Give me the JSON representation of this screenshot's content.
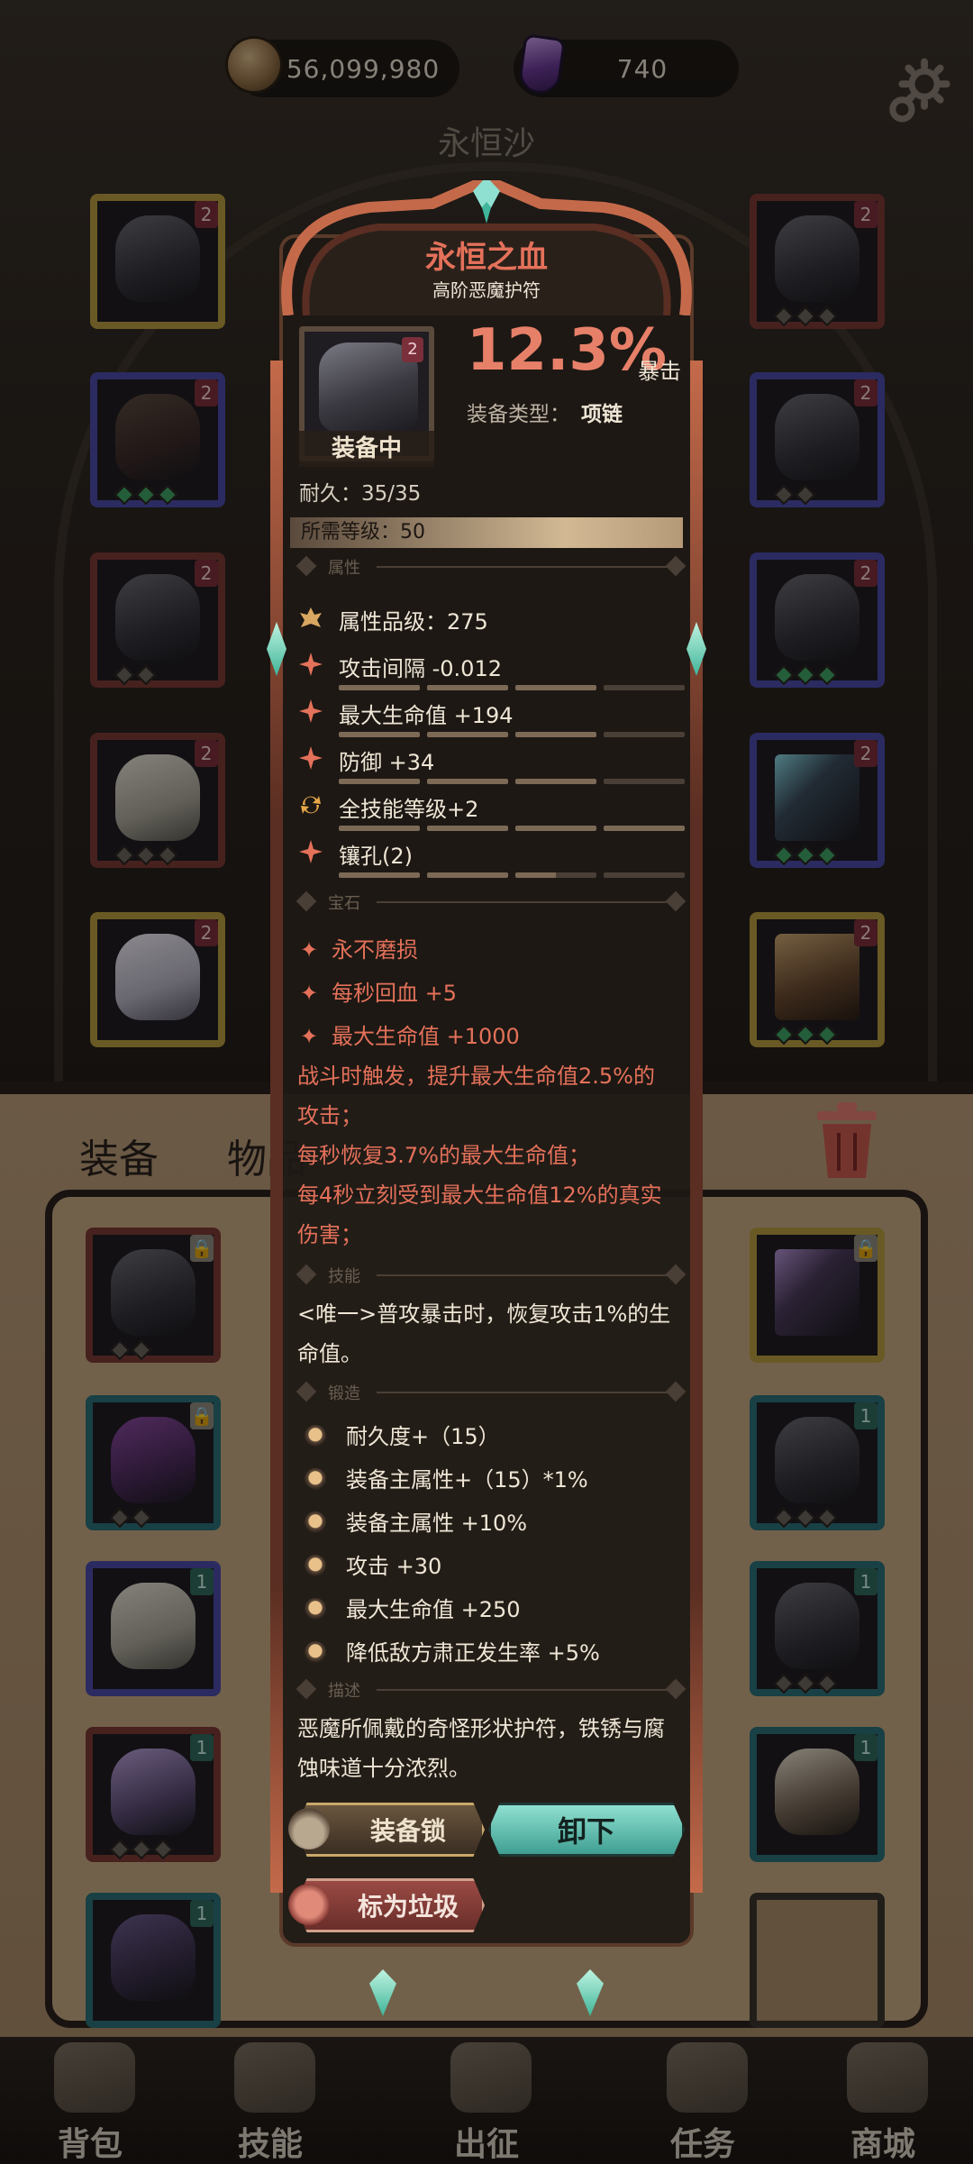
{
  "resources": {
    "gold": "56,099,980",
    "gems": "740"
  },
  "stage_title": "永恒沙",
  "category_tabs": {
    "equip": "装备",
    "items": "物品"
  },
  "bottom_nav": [
    {
      "label": "背包",
      "icon": "backpack-icon"
    },
    {
      "label": "技能",
      "icon": "skill-book-icon"
    },
    {
      "label": "出征",
      "icon": "battle-banner-icon"
    },
    {
      "label": "任务",
      "icon": "quest-scroll-icon"
    },
    {
      "label": "商城",
      "icon": "shop-crown-icon"
    }
  ],
  "slot_badges": {
    "tier": "2",
    "upgrade": "1"
  },
  "tooltip": {
    "name": "永恒之血",
    "subtitle": "高阶恶魔护符",
    "icon_badge": "2",
    "equipped": "装备中",
    "main_value": "12.3%",
    "main_stat": "暴击",
    "type_label": "装备类型：",
    "type_value": "项链",
    "durability": "耐久：35/35",
    "required_level": "所需等级：50",
    "sections": {
      "attributes": "属性",
      "gems": "宝石",
      "skill": "技能",
      "forge": "锻造",
      "description": "描述"
    },
    "attributes": [
      {
        "text": "属性品级：275",
        "icon": "quality-crest-icon"
      },
      {
        "text": "攻击间隔 -0.012",
        "icon": "attribute-sparkle-icon",
        "bar": [
          1,
          1,
          1,
          0
        ]
      },
      {
        "text": "最大生命值 +194",
        "icon": "attribute-sparkle-icon",
        "bar": [
          1,
          1,
          1,
          0
        ]
      },
      {
        "text": "防御 +34",
        "icon": "attribute-sparkle-icon",
        "bar": [
          1,
          1,
          1,
          0
        ]
      },
      {
        "text": "全技能等级+2",
        "icon": "cycle-arrows-icon",
        "bar": [
          1,
          1,
          1,
          1
        ]
      },
      {
        "text": "镶孔(2)",
        "icon": "attribute-sparkle-icon",
        "bar": [
          1,
          1,
          0.5,
          0
        ]
      }
    ],
    "gems": [
      "永不磨损",
      "每秒回血 +5",
      "最大生命值 +1000"
    ],
    "gem_effects": [
      "战斗时触发，提升最大生命值2.5%的攻击；",
      "每秒恢复3.7%的最大生命值；",
      "每4秒立刻受到最大生命值12%的真实伤害；"
    ],
    "skill": "<唯一>普攻暴击时，恢复攻击1%的生命值。",
    "forge": [
      "耐久度+（15）",
      "装备主属性+（15）*1%",
      "装备主属性 +10%",
      "攻击 +30",
      "最大生命值 +250",
      "降低敌方肃正发生率 +5%"
    ],
    "description": "恶魔所佩戴的奇怪形状护符，铁锈与腐蚀味道十分浓烈。",
    "buttons": {
      "lock": "装备锁",
      "unequip": "卸下",
      "junk": "标为垃圾"
    }
  }
}
